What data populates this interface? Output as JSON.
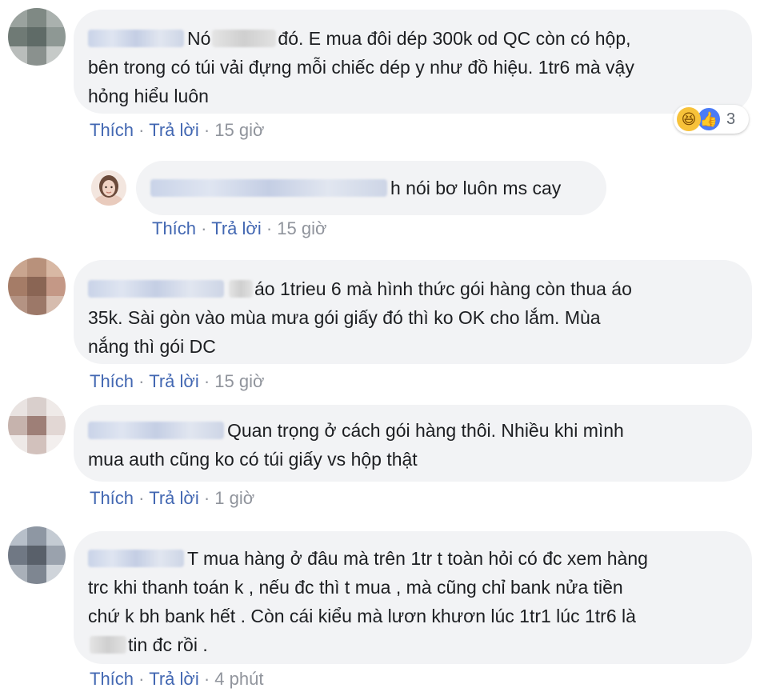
{
  "comments": [
    {
      "text_lines": [
        "Nó",
        "đó. E mua đôi dép 300k od QC còn có hộp,",
        "bên trong có túi vải đựng mỗi chiếc dép y như đồ hiệu. 1tr6 mà vậy",
        "hỏng hiểu luôn"
      ],
      "actions": {
        "like": "Thích",
        "reply": "Trả lời",
        "time": "15 giờ",
        "sep": "·"
      },
      "reaction": {
        "haha_icon": "haha-emoji-icon",
        "like_icon": "thumbs-up-icon",
        "count": "3"
      }
    },
    {
      "text_lines": [
        "h nói bơ luôn ms cay"
      ],
      "actions": {
        "like": "Thích",
        "reply": "Trả lời",
        "time": "15 giờ",
        "sep": "·"
      }
    },
    {
      "text_lines": [
        "áo 1trieu 6 mà hình thức gói hàng còn thua áo",
        "35k. Sài gòn vào mùa mưa gói giấy đó thì ko OK cho lắm. Mùa",
        "nắng thì gói DC"
      ],
      "actions": {
        "like": "Thích",
        "reply": "Trả lời",
        "time": "15 giờ",
        "sep": "·"
      }
    },
    {
      "text_lines": [
        "Quan trọng ở cách gói hàng thôi. Nhiều khi mình",
        "mua auth cũng ko có túi giấy vs hộp thật"
      ],
      "actions": {
        "like": "Thích",
        "reply": "Trả lời",
        "time": "1 giờ",
        "sep": "·"
      }
    },
    {
      "text_lines": [
        "T mua hàng ở đâu mà trên 1tr t toàn hỏi có đc xem hàng",
        "trc khi thanh toán k , nếu đc thì t mua , mà cũng chỉ bank nửa tiền",
        "chứ k bh bank hết . Còn cái kiểu mà lươn khươn lúc 1tr1 lúc 1tr6 là",
        "tin đc rồi ."
      ],
      "actions": {
        "like": "Thích",
        "reply": "Trả lời",
        "time": "4 phút",
        "sep": "·"
      }
    }
  ],
  "colors": {
    "bubble": "#f2f3f5",
    "link": "#4267b2",
    "meta": "#90949c",
    "text": "#1c1e21"
  },
  "reply_avatar_icon": "user-photo-avatar"
}
